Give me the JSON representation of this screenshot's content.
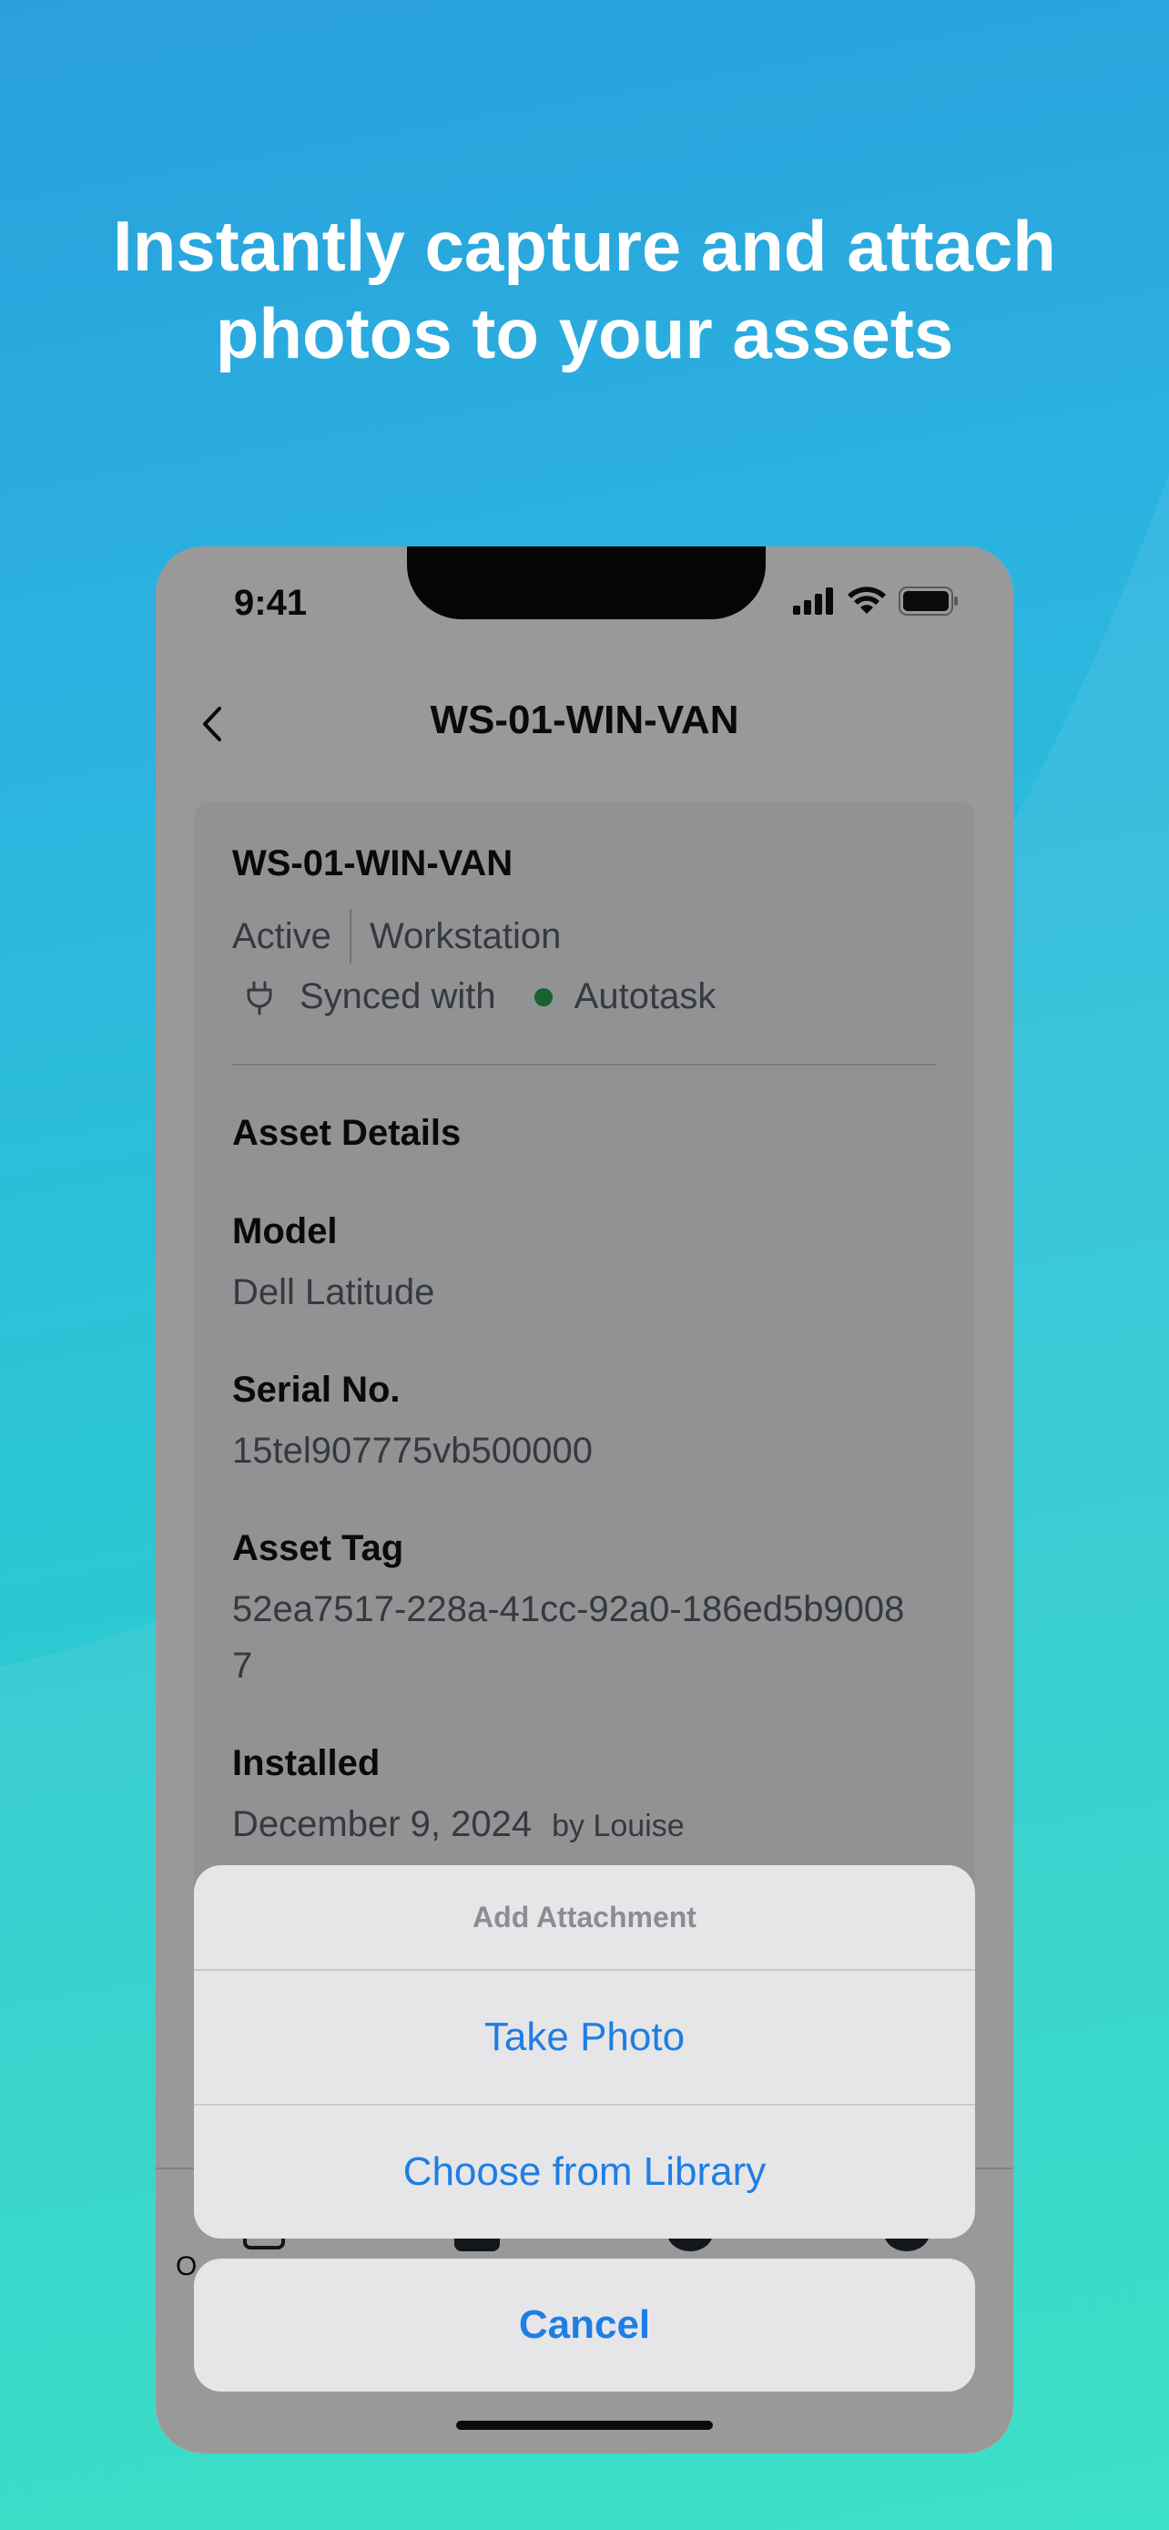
{
  "headline": {
    "line1": "Instantly capture and attach",
    "line2": "photos to your assets"
  },
  "status_bar": {
    "time": "9:41",
    "icons": [
      "signal-icon",
      "wifi-icon",
      "battery-icon"
    ]
  },
  "nav": {
    "title": "WS-01-WIN-VAN",
    "back_icon": "chevron-left-icon"
  },
  "asset": {
    "name": "WS-01-WIN-VAN",
    "status": "Active",
    "type": "Workstation",
    "sync_prefix": "Synced with",
    "sync_target": "Autotask",
    "sync_icon": "plug-icon",
    "sync_dot_color": "#29a64a"
  },
  "details": {
    "section_title": "Asset Details",
    "model_label": "Model",
    "model_value": "Dell Latitude",
    "serial_label": "Serial No.",
    "serial_value": "15tel907775vb500000",
    "tag_label": "Asset Tag",
    "tag_value": "52ea7517-228a-41cc-92a0-186ed5b90087",
    "installed_label": "Installed",
    "installed_value": "December 9, 2024",
    "installed_by": "by Louise"
  },
  "tab_bar": {
    "partial_label": "O"
  },
  "action_sheet": {
    "title": "Add Attachment",
    "take_photo": "Take Photo",
    "choose_library": "Choose from Library",
    "cancel": "Cancel"
  },
  "colors": {
    "accent": "#1f7ee4",
    "gradient_top": "#2a9fdc",
    "gradient_bottom": "#2ddfc2"
  }
}
